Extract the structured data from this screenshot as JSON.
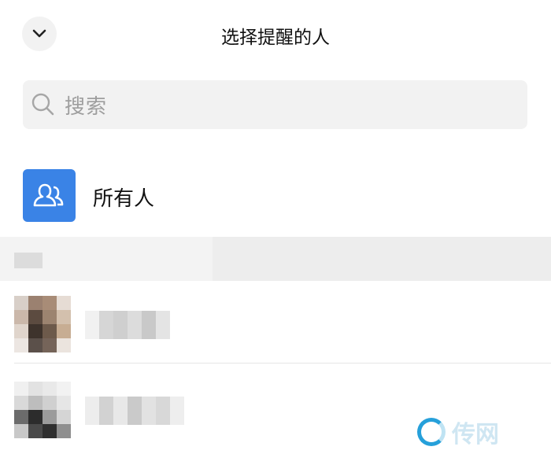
{
  "header": {
    "title": "选择提醒的人"
  },
  "search": {
    "placeholder": "搜索"
  },
  "all_members": {
    "label": "所有人"
  },
  "colors": {
    "accent": "#3a83e6",
    "search_bg": "#f2f2f2",
    "section_bg": "#ededed"
  },
  "icons": {
    "collapse": "chevron-down-icon",
    "search": "search-icon",
    "group": "group-people-icon"
  },
  "watermark": {
    "text": "传网"
  }
}
